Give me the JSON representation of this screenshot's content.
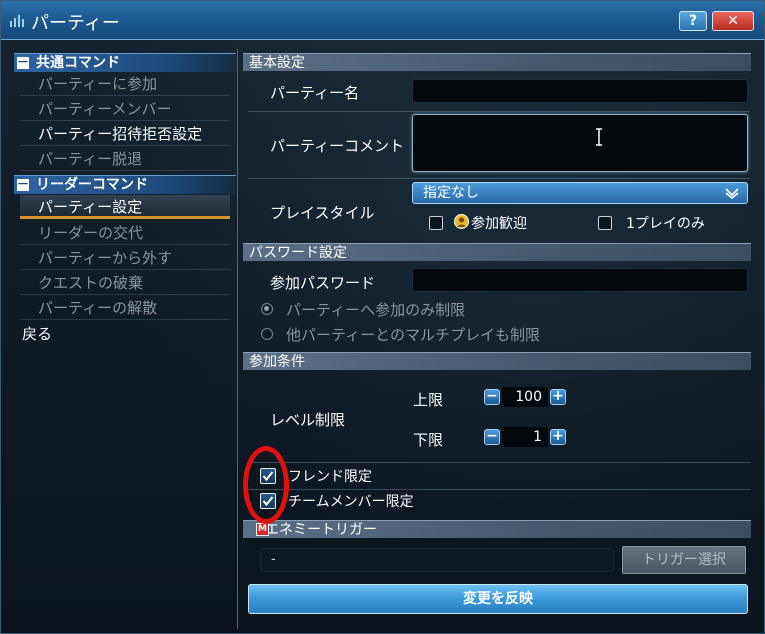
{
  "window": {
    "title": "パーティー",
    "help_label": "?",
    "close_label": "✕"
  },
  "sidebar": {
    "common_header": "共通コマンド",
    "common_items": [
      {
        "label": "パーティーに参加",
        "state": "disabled"
      },
      {
        "label": "パーティーメンバー",
        "state": "disabled"
      },
      {
        "label": "パーティー招待拒否設定",
        "state": "enabled"
      },
      {
        "label": "パーティー脱退",
        "state": "disabled"
      }
    ],
    "leader_header": "リーダーコマンド",
    "leader_items": [
      {
        "label": "パーティー設定",
        "state": "selected"
      },
      {
        "label": "リーダーの交代",
        "state": "disabled"
      },
      {
        "label": "パーティーから外す",
        "state": "disabled"
      },
      {
        "label": "クエストの破棄",
        "state": "disabled"
      },
      {
        "label": "パーティーの解散",
        "state": "disabled"
      }
    ],
    "back_label": "戻る",
    "collapse_symbol": "－"
  },
  "basic": {
    "header": "基本設定",
    "party_name_label": "パーティー名",
    "party_name_value": "",
    "comment_label": "パーティーコメント",
    "comment_value": "",
    "playstyle_label": "プレイスタイル",
    "playstyle_selected": "指定なし",
    "opt_join_welcome": "参加歓迎",
    "opt_join_welcome_checked": false,
    "opt_one_play": "1プレイのみ",
    "opt_one_play_checked": false
  },
  "password": {
    "header": "パスワード設定",
    "label": "参加パスワード",
    "value": "",
    "radio_join_only": "パーティーへ参加のみ制限",
    "radio_multi": "他パーティーとのマルチプレイも制限",
    "selected": "join_only"
  },
  "conditions": {
    "header": "参加条件",
    "level_label": "レベル制限",
    "upper_label": "上限",
    "upper_value": "100",
    "lower_label": "下限",
    "lower_value": "1",
    "minus": "−",
    "plus": "+",
    "friend_only": "フレンド限定",
    "friend_only_checked": true,
    "team_only": "チームメンバー限定",
    "team_only_checked": true
  },
  "enemy_trigger": {
    "header": "エネミートリガー",
    "value": "-",
    "select_button": "トリガー選択"
  },
  "apply_button": "変更を反映",
  "colors": {
    "accent_blue": "#2d6fa8",
    "selected_underline": "#d8902a",
    "annotation_red": "#e01010"
  }
}
